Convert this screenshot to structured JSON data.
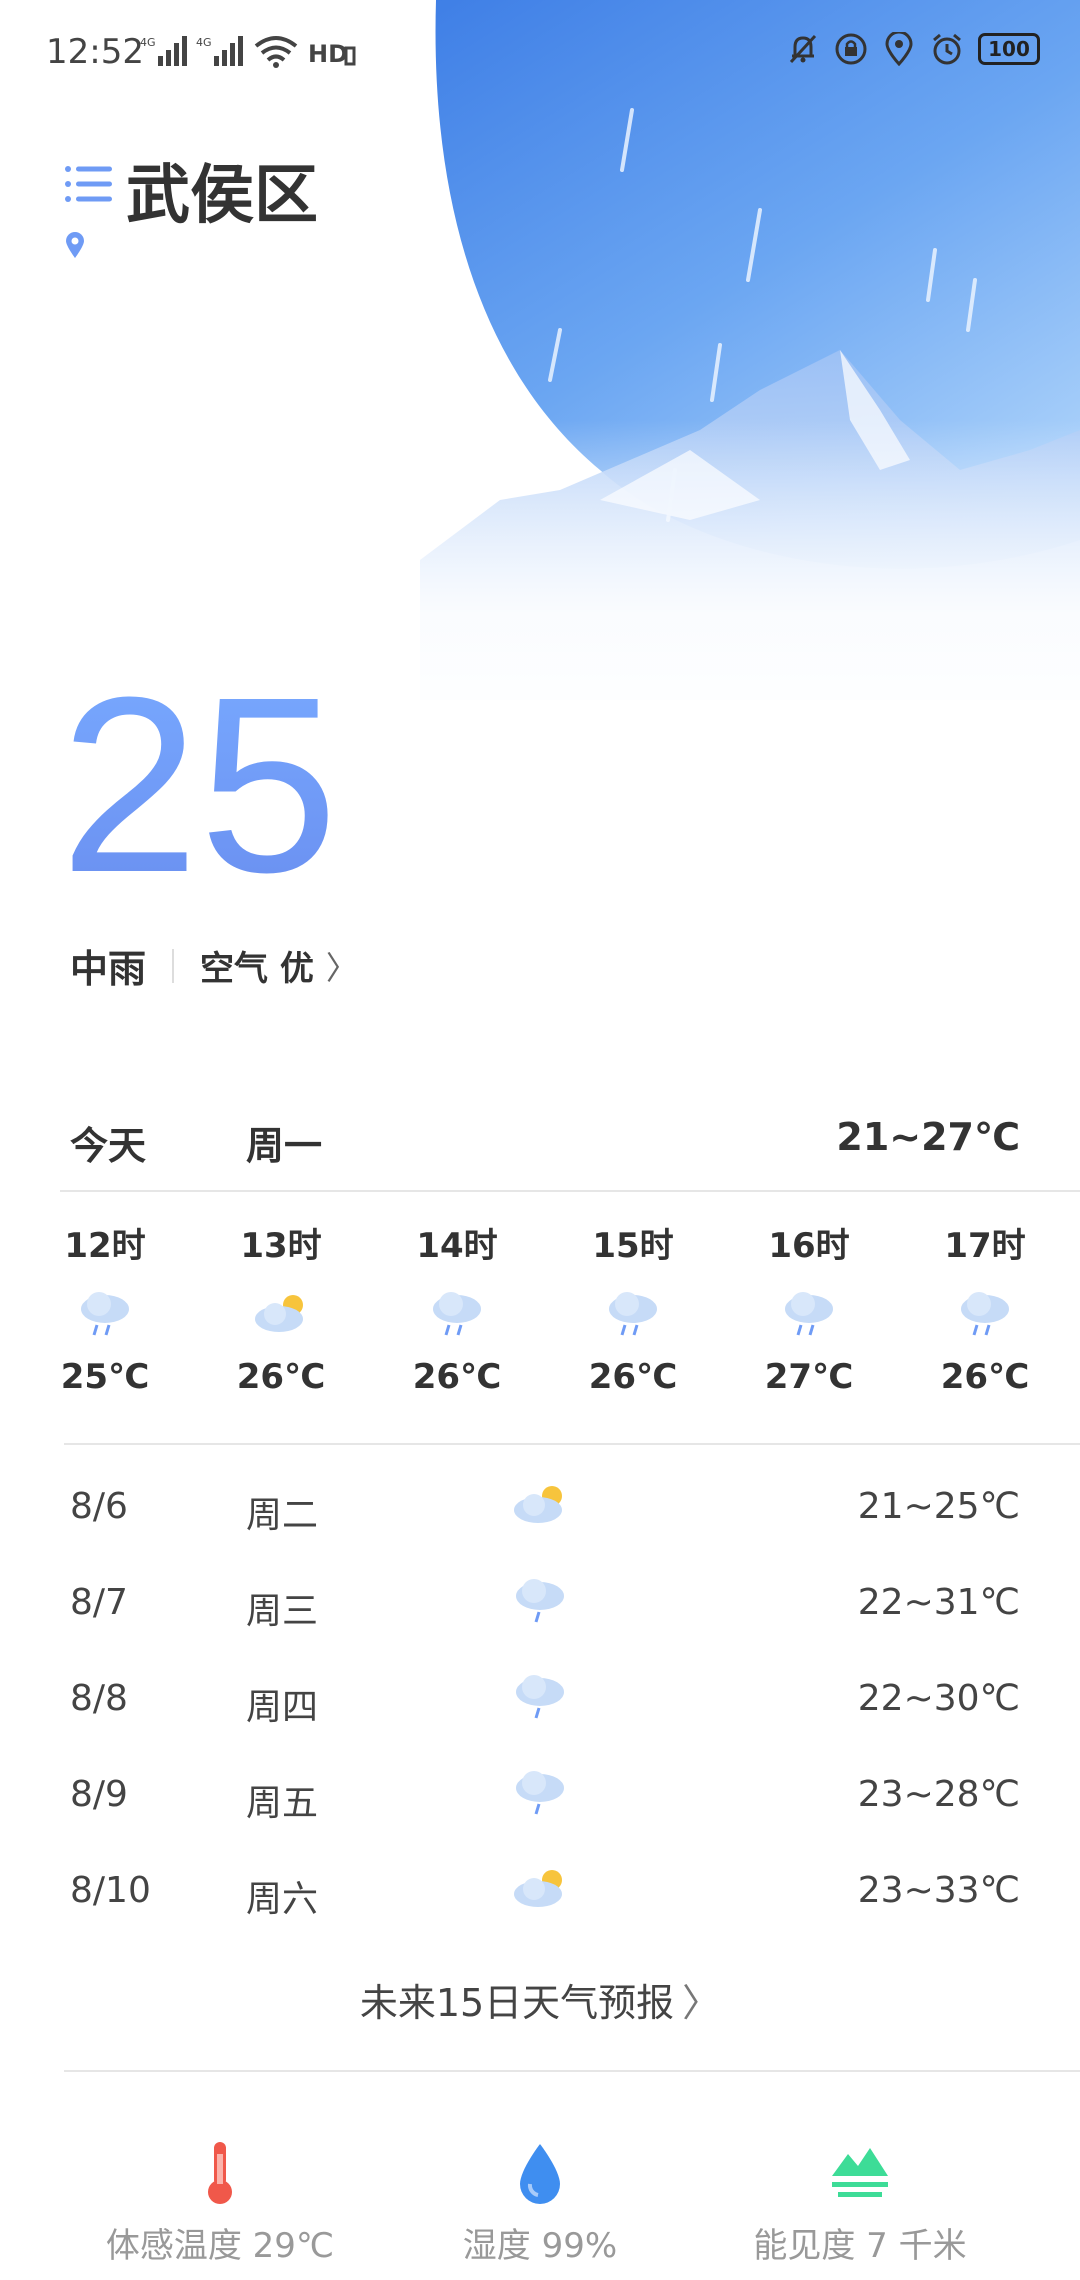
{
  "status_bar": {
    "time": "12:52",
    "battery": "100",
    "signal_icons": [
      "4g-signal-icon",
      "4g-signal-icon",
      "wifi-icon",
      "hd-icon"
    ],
    "right_icons": [
      "bell-off-icon",
      "lock-rotation-icon",
      "location-icon",
      "alarm-icon"
    ]
  },
  "header": {
    "city": "武侯区"
  },
  "current": {
    "temp": "25",
    "condition": "中雨",
    "air": "空气 优"
  },
  "today": {
    "label": "今天",
    "weekday": "周一",
    "range": "21~27℃"
  },
  "hourly": [
    {
      "time": "12时",
      "icon": "rain-icon",
      "temp": "25℃"
    },
    {
      "time": "13时",
      "icon": "partly-cloudy-icon",
      "temp": "26℃"
    },
    {
      "time": "14时",
      "icon": "rain-icon",
      "temp": "26℃"
    },
    {
      "time": "15时",
      "icon": "rain-icon",
      "temp": "26℃"
    },
    {
      "time": "16时",
      "icon": "rain-icon",
      "temp": "27℃"
    },
    {
      "time": "17时",
      "icon": "rain-icon",
      "temp": "26℃"
    }
  ],
  "daily": [
    {
      "date": "8/6",
      "weekday": "周二",
      "icon": "partly-cloudy-icon",
      "range": "21~25℃"
    },
    {
      "date": "8/7",
      "weekday": "周三",
      "icon": "light-rain-icon",
      "range": "22~31℃"
    },
    {
      "date": "8/8",
      "weekday": "周四",
      "icon": "light-rain-icon",
      "range": "22~30℃"
    },
    {
      "date": "8/9",
      "weekday": "周五",
      "icon": "light-rain-icon",
      "range": "23~28℃"
    },
    {
      "date": "8/10",
      "weekday": "周六",
      "icon": "partly-cloudy-icon",
      "range": "23~33℃"
    }
  ],
  "forecast_link": "未来15日天气预报",
  "metrics": [
    {
      "icon": "thermometer-icon",
      "label": "体感温度 29℃"
    },
    {
      "icon": "water-drop-icon",
      "label": "湿度 99%"
    },
    {
      "icon": "visibility-icon",
      "label": "能见度 7 千米"
    }
  ],
  "colors": {
    "accent": "#6f9bf5",
    "thermometer": "#f0584a",
    "drop": "#3f8ef0",
    "visibility": "#3ddc97"
  }
}
